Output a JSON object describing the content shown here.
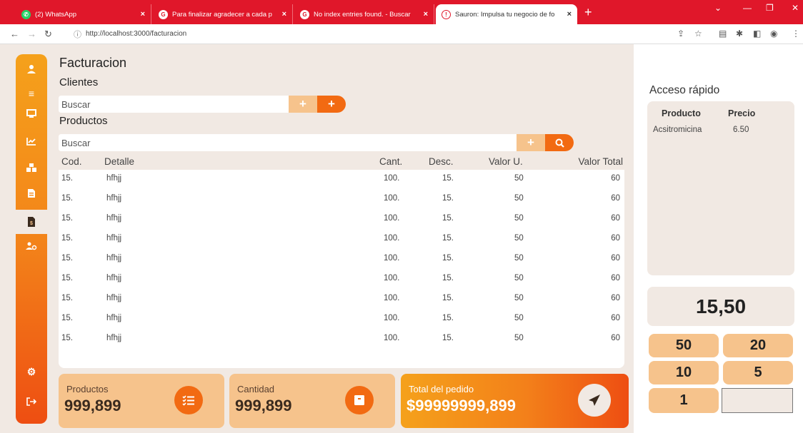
{
  "browser": {
    "tabs": [
      {
        "title": "(2) WhatsApp",
        "favicon": "whatsapp-icon",
        "favicon_color": "#25d366"
      },
      {
        "title": "Para finalizar agradecer a cada p",
        "favicon": "google-icon",
        "favicon_color": "#ffffff"
      },
      {
        "title": "No index entries found. - Buscar",
        "favicon": "google-icon",
        "favicon_color": "#ffffff"
      },
      {
        "title": "Sauron: Impulsa tu negocio de fo",
        "favicon": "sauron-icon",
        "favicon_color": "#e0172a"
      }
    ],
    "url": "http://localhost:3000/facturacion"
  },
  "colors": {
    "accent_orange": "#f26a12",
    "accent_light": "#f6c38c",
    "sidebar_top": "#f5a11b",
    "sidebar_bottom": "#ee4e12",
    "chrome_red": "#e0172a",
    "background": "#f1e9e3"
  },
  "sidebar": {
    "items": [
      {
        "icon": "user-icon",
        "glyph": "👤"
      },
      {
        "icon": "menu-icon",
        "glyph": "≡"
      },
      {
        "icon": "display-icon",
        "glyph": "▭"
      },
      {
        "icon": "chart-line-icon",
        "glyph": "📈"
      },
      {
        "icon": "boxes-icon",
        "glyph": "▦"
      },
      {
        "icon": "document-icon",
        "glyph": "▤"
      },
      {
        "icon": "invoice-dollar-icon",
        "glyph": "$",
        "active": true
      },
      {
        "icon": "users-cog-icon",
        "glyph": "👥"
      }
    ],
    "bottom": [
      {
        "icon": "settings-icon",
        "glyph": "⚙"
      },
      {
        "icon": "logout-icon",
        "glyph": "⇥"
      }
    ]
  },
  "page": {
    "title": "Facturacion",
    "clients_label": "Clientes",
    "clients_search_placeholder": "Buscar",
    "products_label": "Productos",
    "products_search_placeholder": "Buscar",
    "plus_symbol": "+",
    "search_symbol": "🔍"
  },
  "table": {
    "headers": {
      "cod": "Cod.",
      "detalle": "Detalle",
      "cant": "Cant.",
      "desc": "Desc.",
      "valor_u": "Valor U.",
      "valor_total": "Valor Total"
    },
    "rows": [
      {
        "cod": "15.",
        "detalle": "hfhjj",
        "cant": "100.",
        "desc": "15.",
        "valor_u": "50",
        "valor_total": "60"
      },
      {
        "cod": "15.",
        "detalle": "hfhjj",
        "cant": "100.",
        "desc": "15.",
        "valor_u": "50",
        "valor_total": "60"
      },
      {
        "cod": "15.",
        "detalle": "hfhjj",
        "cant": "100.",
        "desc": "15.",
        "valor_u": "50",
        "valor_total": "60"
      },
      {
        "cod": "15.",
        "detalle": "hfhjj",
        "cant": "100.",
        "desc": "15.",
        "valor_u": "50",
        "valor_total": "60"
      },
      {
        "cod": "15.",
        "detalle": "hfhjj",
        "cant": "100.",
        "desc": "15.",
        "valor_u": "50",
        "valor_total": "60"
      },
      {
        "cod": "15.",
        "detalle": "hfhjj",
        "cant": "100.",
        "desc": "15.",
        "valor_u": "50",
        "valor_total": "60"
      },
      {
        "cod": "15.",
        "detalle": "hfhjj",
        "cant": "100.",
        "desc": "15.",
        "valor_u": "50",
        "valor_total": "60"
      },
      {
        "cod": "15.",
        "detalle": "hfhjj",
        "cant": "100.",
        "desc": "15.",
        "valor_u": "50",
        "valor_total": "60"
      },
      {
        "cod": "15.",
        "detalle": "hfhjj",
        "cant": "100.",
        "desc": "15.",
        "valor_u": "50",
        "valor_total": "60"
      }
    ]
  },
  "summary": {
    "productos": {
      "label": "Productos",
      "value": "999,899",
      "icon": "list-check-icon"
    },
    "cantidad": {
      "label": "Cantidad",
      "value": "999,899",
      "icon": "box-icon"
    },
    "total": {
      "label": "Total del pedido",
      "value": "$99999999,899",
      "icon": "paper-plane-icon"
    }
  },
  "quick_access": {
    "title": "Acceso rápido",
    "headers": {
      "producto": "Producto",
      "precio": "Precio"
    },
    "items": [
      {
        "producto": "Acsitromicina",
        "precio": "6.50"
      }
    ],
    "display": "15,50",
    "keys": [
      "50",
      "20",
      "10",
      "5",
      "1"
    ]
  }
}
